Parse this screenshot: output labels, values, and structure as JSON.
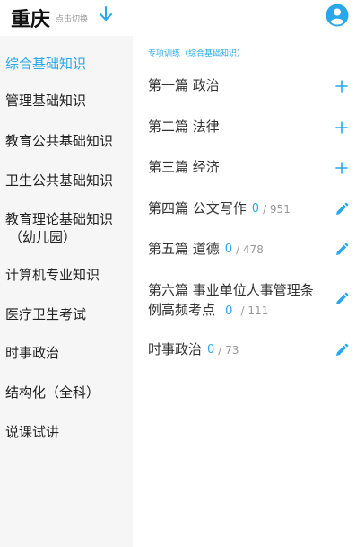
{
  "header": {
    "city": "重庆",
    "switch_hint": "点击切换",
    "accent_color": "#2aa7e8",
    "icons": {
      "switch": "arrow-down-icon",
      "profile": "user-avatar-icon"
    }
  },
  "sidebar": {
    "items": [
      {
        "label": "综合基础知识",
        "active": true
      },
      {
        "label": "管理基础知识"
      },
      {
        "label": "教育公共基础知识"
      },
      {
        "label": "卫生公共基础知识"
      },
      {
        "label_line1": "教育理论基础知识",
        "label_line2": "（幼儿园）"
      },
      {
        "label": "计算机专业知识"
      },
      {
        "label": "医疗卫生考试"
      },
      {
        "label": "时事政治"
      },
      {
        "label": "结构化（全科）"
      },
      {
        "label": "说课试讲"
      }
    ]
  },
  "main": {
    "section_title": "专项训练（综合基础知识）",
    "rows": [
      {
        "title": "第一篇  政治",
        "action_icon": "plus-icon"
      },
      {
        "title": "第二篇  法律",
        "action_icon": "plus-icon"
      },
      {
        "title": "第三篇  经济",
        "action_icon": "plus-icon"
      },
      {
        "title": "第四篇  公文写作",
        "count": "0",
        "total": "/ 951",
        "action_icon": "pencil-icon"
      },
      {
        "title": "第五篇  道德",
        "count": "0",
        "total": "/ 478",
        "action_icon": "pencil-icon"
      },
      {
        "title_line1": "第六篇  事业单位人事管理条",
        "title_line2": "例高频考点",
        "count": "0",
        "total": "/ 111",
        "action_icon": "pencil-icon"
      },
      {
        "title": "时事政治",
        "count": "0",
        "total": "/ 73",
        "action_icon": "pencil-icon"
      }
    ]
  }
}
